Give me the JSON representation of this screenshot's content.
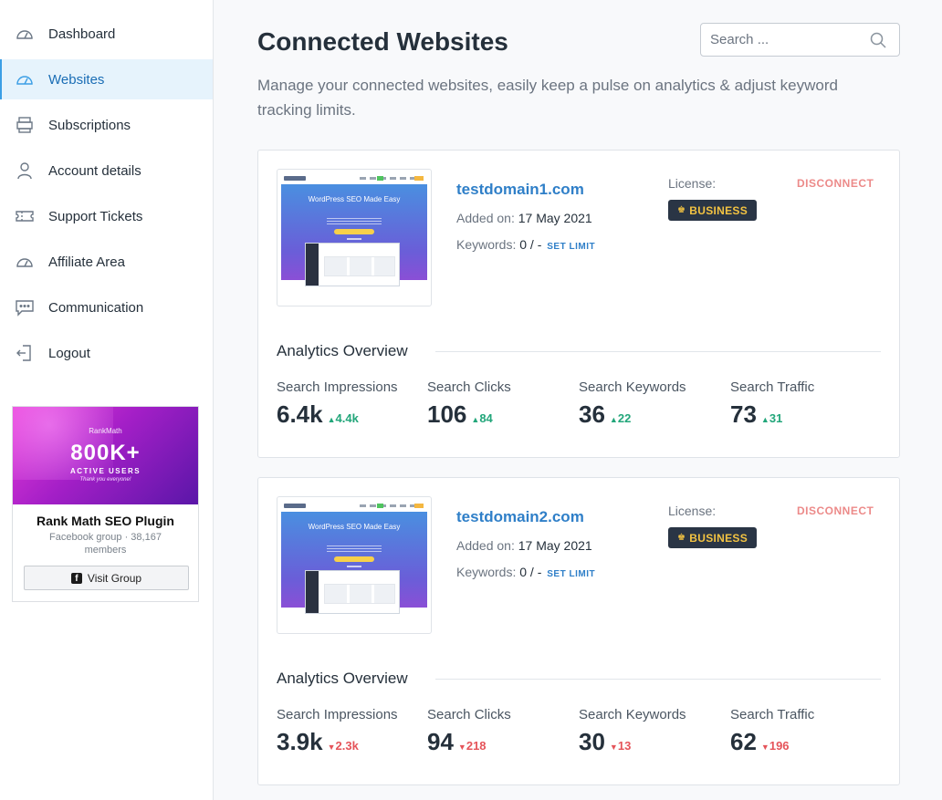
{
  "sidebar": {
    "items": [
      {
        "label": "Dashboard",
        "icon": "dashboard-icon"
      },
      {
        "label": "Websites",
        "icon": "websites-icon",
        "active": true
      },
      {
        "label": "Subscriptions",
        "icon": "subscriptions-icon"
      },
      {
        "label": "Account details",
        "icon": "user-icon"
      },
      {
        "label": "Support Tickets",
        "icon": "ticket-icon"
      },
      {
        "label": "Affiliate Area",
        "icon": "affiliate-icon"
      },
      {
        "label": "Communication",
        "icon": "chat-icon"
      },
      {
        "label": "Logout",
        "icon": "logout-icon"
      }
    ],
    "promo": {
      "brand": "RankMath",
      "headline": "800K+",
      "subline": "ACTIVE USERS",
      "thanks": "Thank you everyone!",
      "title": "Rank Math SEO Plugin",
      "meta": "Facebook group · 38,167 members",
      "button_label": "Visit Group"
    }
  },
  "header": {
    "title": "Connected Websites",
    "search_placeholder": "Search ...",
    "description": "Manage your connected websites, easily keep a pulse on analytics & adjust keyword tracking limits."
  },
  "colors": {
    "accent": "#2f7fc8",
    "up": "#22a67a",
    "down": "#e5545a",
    "disconnect": "#ec8a89",
    "badge_bg": "#2a3545",
    "badge_text": "#f3c342"
  },
  "websites": [
    {
      "domain": "testdomain1.com",
      "added_label": "Added on:",
      "added_date": "17 May 2021",
      "keywords_label": "Keywords:",
      "keywords_value": "0 / -",
      "set_limit": "SET LIMIT",
      "license_label": "License:",
      "license": "BUSINESS",
      "disconnect": "DISCONNECT",
      "thumb_heading": "WordPress SEO Made Easy",
      "analytics_title": "Analytics Overview",
      "metrics": [
        {
          "label": "Search Impressions",
          "value": "6.4k",
          "delta": "4.4k",
          "trend": "up"
        },
        {
          "label": "Search Clicks",
          "value": "106",
          "delta": "84",
          "trend": "up"
        },
        {
          "label": "Search Keywords",
          "value": "36",
          "delta": "22",
          "trend": "up"
        },
        {
          "label": "Search Traffic",
          "value": "73",
          "delta": "31",
          "trend": "up"
        }
      ]
    },
    {
      "domain": "testdomain2.com",
      "added_label": "Added on:",
      "added_date": "17 May 2021",
      "keywords_label": "Keywords:",
      "keywords_value": "0 / -",
      "set_limit": "SET LIMIT",
      "license_label": "License:",
      "license": "BUSINESS",
      "disconnect": "DISCONNECT",
      "thumb_heading": "WordPress SEO Made Easy",
      "analytics_title": "Analytics Overview",
      "metrics": [
        {
          "label": "Search Impressions",
          "value": "3.9k",
          "delta": "2.3k",
          "trend": "down"
        },
        {
          "label": "Search Clicks",
          "value": "94",
          "delta": "218",
          "trend": "down"
        },
        {
          "label": "Search Keywords",
          "value": "30",
          "delta": "13",
          "trend": "down"
        },
        {
          "label": "Search Traffic",
          "value": "62",
          "delta": "196",
          "trend": "down"
        }
      ]
    }
  ]
}
